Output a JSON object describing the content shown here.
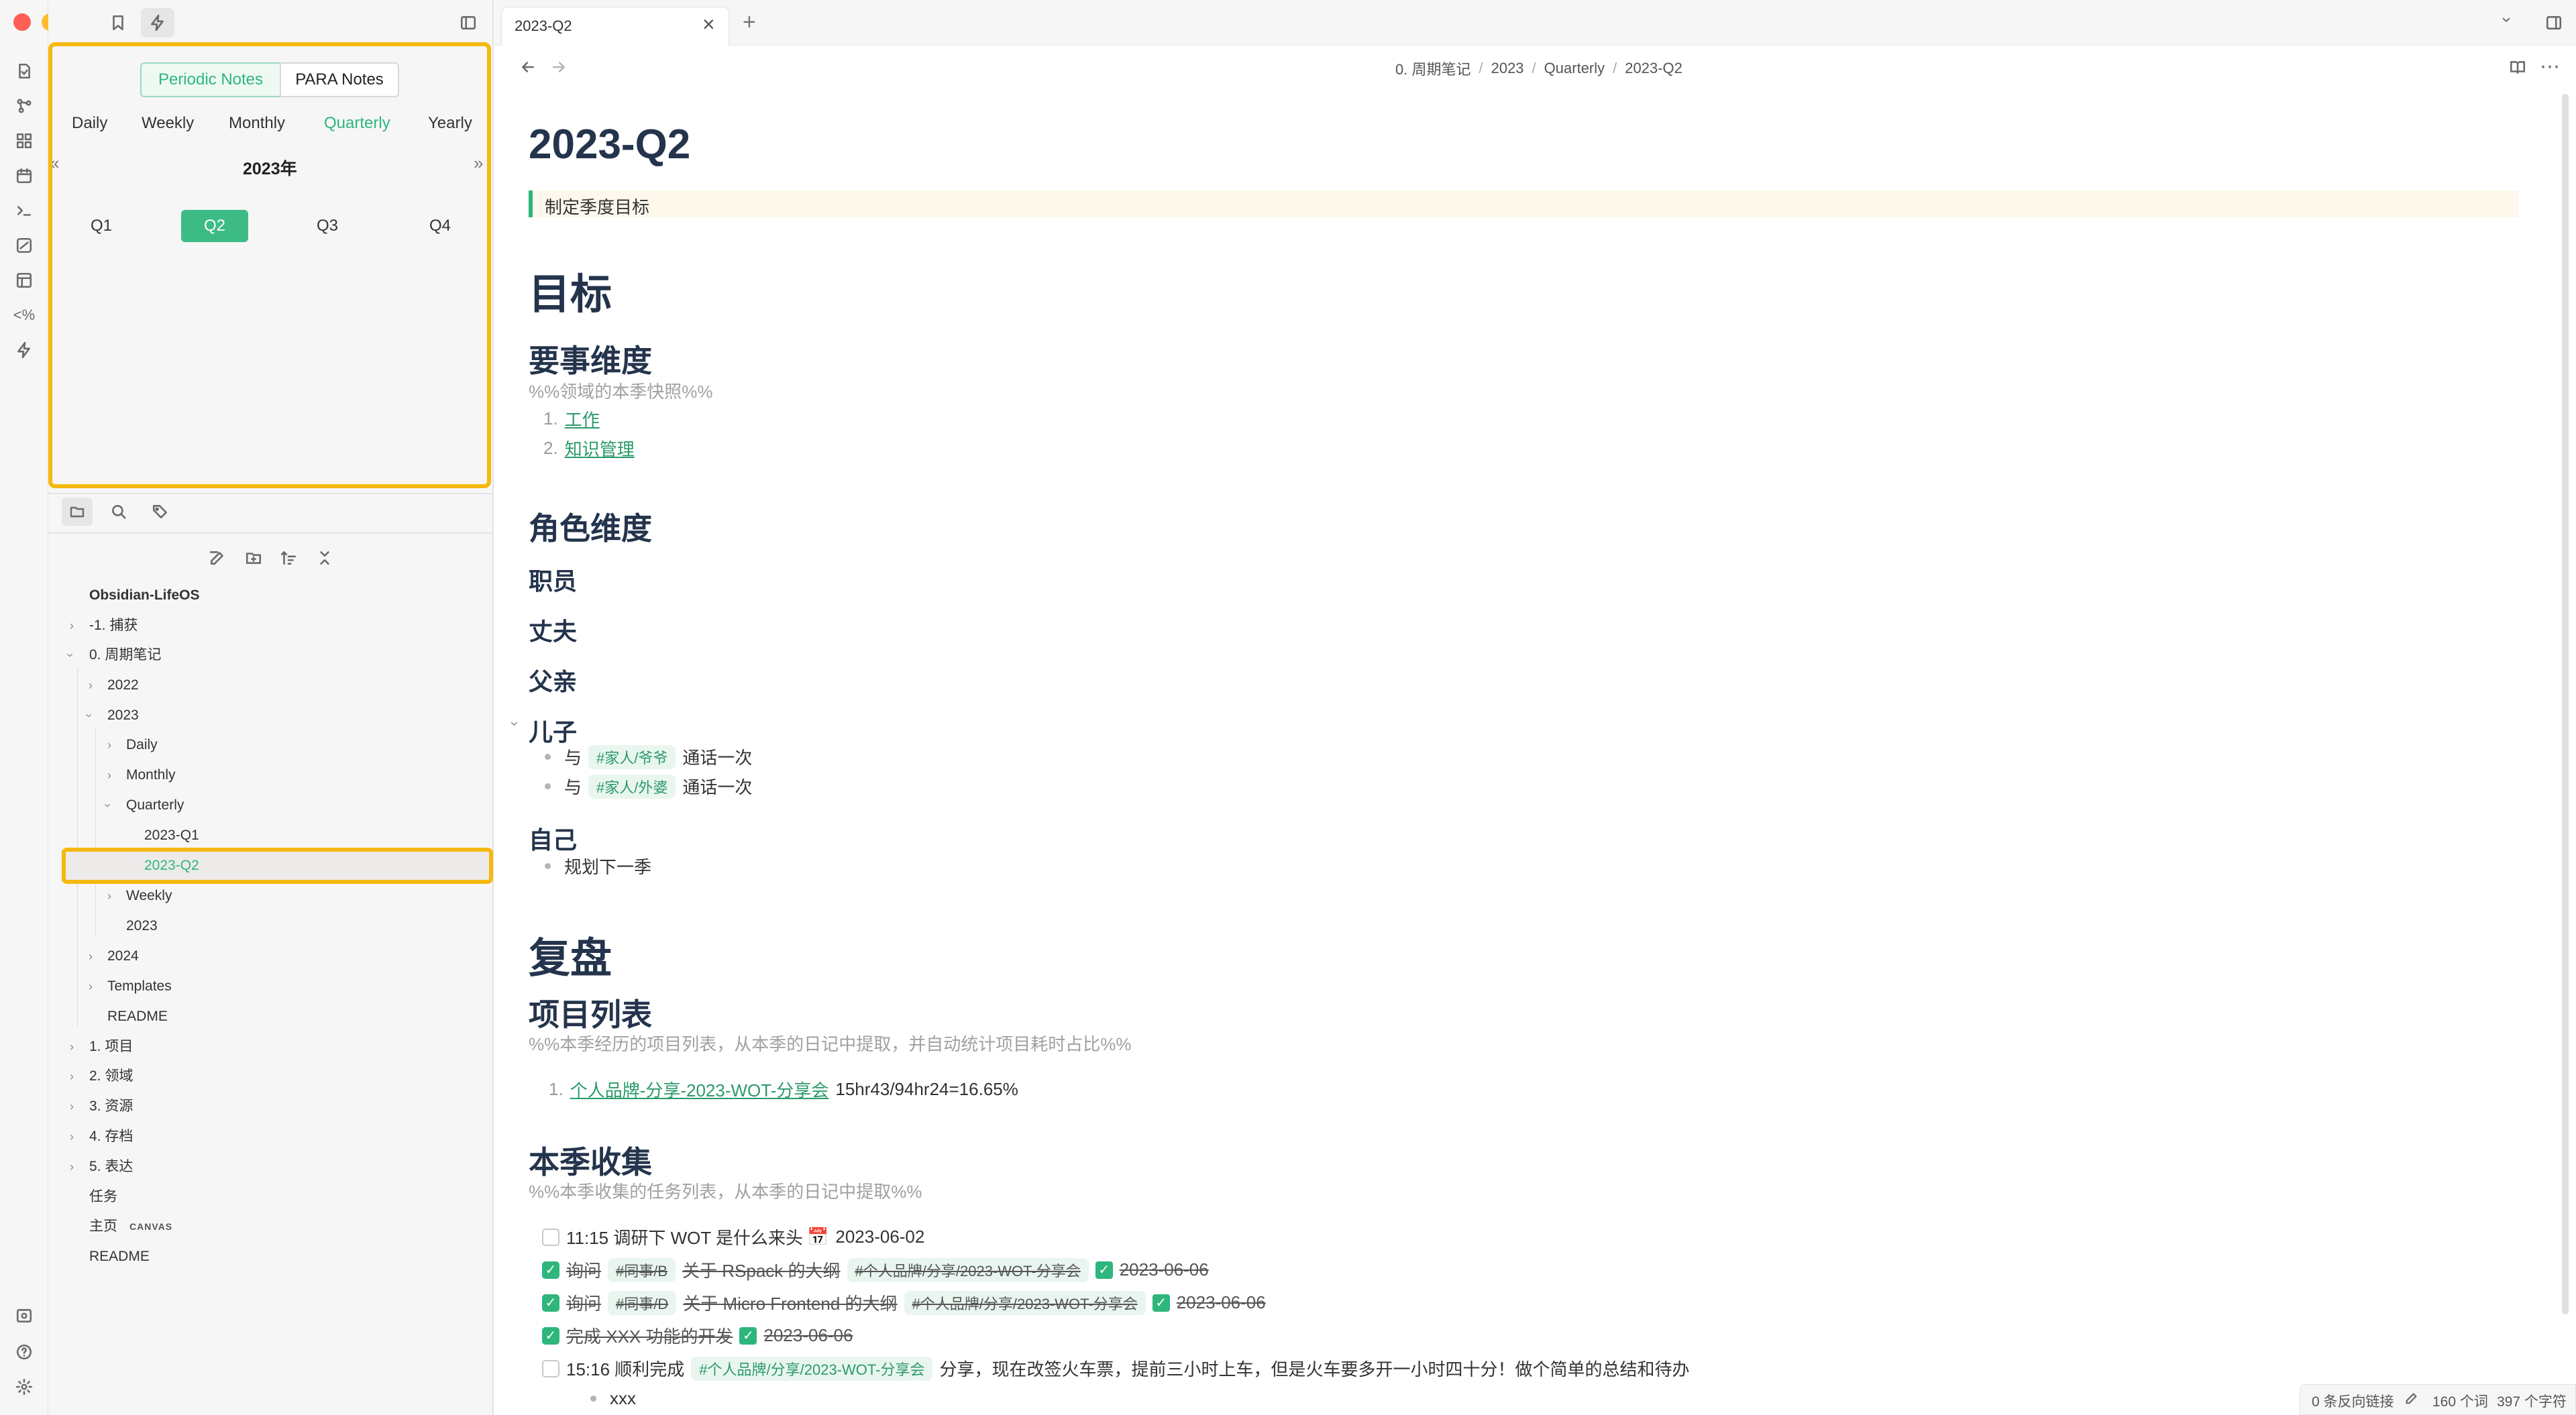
{
  "window": {
    "traffic_colors": [
      "#fe5f57",
      "#febc2e",
      "#28c840"
    ]
  },
  "tab": {
    "title": "2023-Q2",
    "close": "×",
    "new": "+"
  },
  "breadcrumb": [
    "0. 周期笔记",
    "2023",
    "Quarterly",
    "2023-Q2"
  ],
  "breadcrumb_sep": "/",
  "periodic": {
    "segments": [
      "Periodic Notes",
      "PARA Notes"
    ],
    "tabs": [
      "Daily",
      "Weekly",
      "Monthly",
      "Quarterly",
      "Yearly"
    ],
    "year": "2023年",
    "quarters": [
      "Q1",
      "Q2",
      "Q3",
      "Q4"
    ],
    "selected_quarter": "Q2",
    "nav_prev": "«",
    "nav_next": "»"
  },
  "accent": "#2eb67d",
  "highlight": "#f5b90f",
  "tree": {
    "vault": "Obsidian-LifeOS",
    "items": [
      {
        "label": "-1. 捕获"
      },
      {
        "label": "0. 周期笔记"
      },
      {
        "label": "2022"
      },
      {
        "label": "2023"
      },
      {
        "label": "Daily"
      },
      {
        "label": "Monthly"
      },
      {
        "label": "Quarterly"
      },
      {
        "label": "2023-Q1"
      },
      {
        "label": "2023-Q2"
      },
      {
        "label": "Weekly"
      },
      {
        "label": "2023"
      },
      {
        "label": "2024"
      },
      {
        "label": "Templates"
      },
      {
        "label": "README"
      },
      {
        "label": "1. 项目"
      },
      {
        "label": "2. 领域"
      },
      {
        "label": "3. 资源"
      },
      {
        "label": "4. 存档"
      },
      {
        "label": "5. 表达"
      },
      {
        "label": "任务"
      },
      {
        "label": "主页"
      },
      {
        "label": "README"
      }
    ],
    "canvas_badge": "CANVAS"
  },
  "note": {
    "title": "2023-Q2",
    "quote": "制定季度目标",
    "h_goals": "目标",
    "h_key": "要事维度",
    "c_key": "%%领域的本季快照%%",
    "key_items": [
      {
        "n": "1.",
        "label": "工作"
      },
      {
        "n": "2.",
        "label": "知识管理"
      }
    ],
    "h_roles": "角色维度",
    "role1": "职员",
    "role2": "丈夫",
    "role3": "父亲",
    "role4": "儿子",
    "son_items": [
      {
        "pre": "与",
        "tag": "#家人/爷爷",
        "post": "通话一次"
      },
      {
        "pre": "与",
        "tag": "#家人/外婆",
        "post": "通话一次"
      }
    ],
    "role5": "自己",
    "self_item": "规划下一季",
    "h_review": "复盘",
    "h_projects": "项目列表",
    "c_projects": "%%本季经历的项目列表，从本季的日记中提取，并自动统计项目耗时占比%%",
    "project": {
      "n": "1.",
      "link": "个人品牌-分享-2023-WOT-分享会",
      "stat": "15hr43/94hr24=16.65%"
    },
    "h_collect": "本季收集",
    "c_collect": "%%本季收集的任务列表，从本季的日记中提取%%",
    "tasks": {
      "t1": {
        "text": "11:15 调研下 WOT 是什么来头",
        "cal": "📅",
        "date": "2023-06-02"
      },
      "t2": {
        "a": "询问",
        "tag1": "#同事/B",
        "b": "关于 RSpack 的大纲",
        "tag2": "#个人品牌/分享/2023-WOT-分享会",
        "date": "2023-06-06"
      },
      "t3": {
        "a": "询问",
        "tag1": "#同事/D",
        "b": "关于 Micro Frontend 的大纲",
        "tag2": "#个人品牌/分享/2023-WOT-分享会",
        "date": "2023-06-06"
      },
      "t4": {
        "a": "完成 XXX 功能的开发",
        "date": "2023-06-06"
      },
      "t5": {
        "a": "15:16 顺利完成",
        "tag": "#个人品牌/分享/2023-WOT-分享会",
        "b": "分享，现在改签火车票，提前三小时上车，但是火车要多开一小时四十分！做个简单的总结和待办"
      },
      "sub": "xxx"
    }
  },
  "statusbar": {
    "backlinks": "0 条反向链接",
    "words": "160 个词",
    "chars": "397 个字符"
  }
}
